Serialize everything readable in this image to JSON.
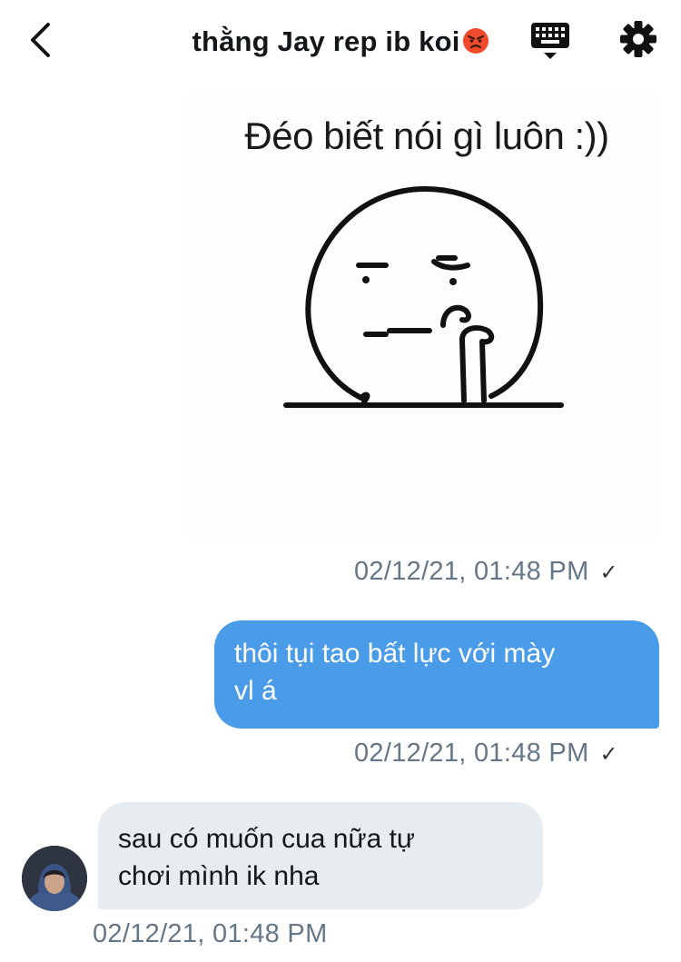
{
  "header": {
    "title": "thằng Jay rep ib koi",
    "title_emoji": "angry-face-emoji",
    "back_icon": "chevron-left-icon",
    "keyboard_icon": "keyboard-icon",
    "settings_icon": "gear-icon"
  },
  "messages": [
    {
      "direction": "outgoing",
      "type": "image",
      "image_caption": "Đéo biết nói gì luôn :))",
      "timestamp": "02/12/21, 01:48 PM",
      "status_icon": "checkmark-icon"
    },
    {
      "direction": "outgoing",
      "type": "text",
      "lines": [
        "thôi tụi tao bất lực với mày",
        "vl á"
      ],
      "timestamp": "02/12/21, 01:48 PM",
      "status_icon": "checkmark-icon"
    },
    {
      "direction": "incoming",
      "type": "text",
      "lines": [
        "sau có muốn cua nữa tự",
        "chơi mình ik nha"
      ],
      "timestamp": "02/12/21, 01:48 PM"
    }
  ],
  "colors": {
    "outgoing_bubble": "#4a9ce8",
    "incoming_bubble": "#e6ecf0",
    "timestamp_text": "#657786"
  }
}
